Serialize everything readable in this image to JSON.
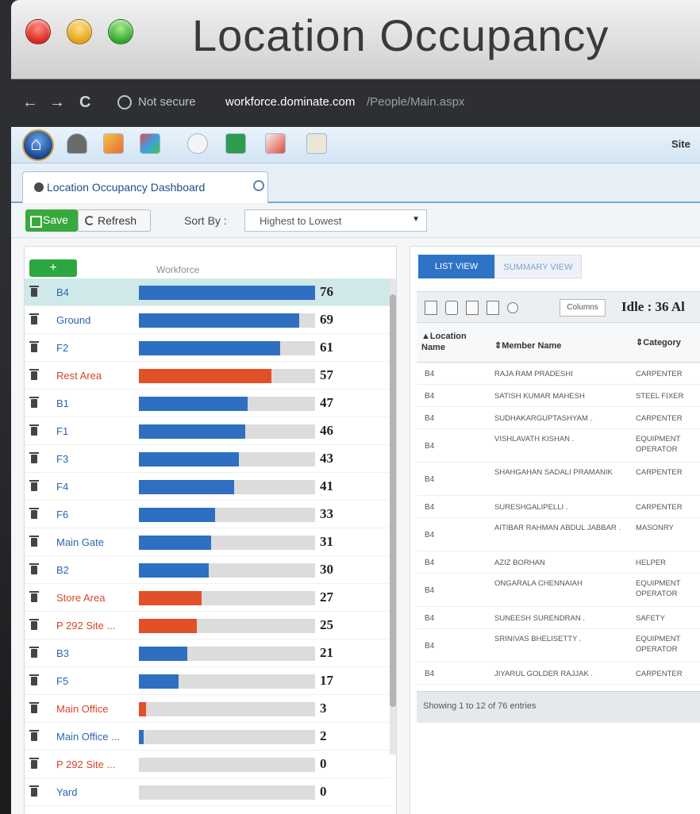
{
  "window": {
    "title": "Location Occupancy"
  },
  "browser": {
    "back": "←",
    "forward": "→",
    "reload": "C",
    "not_secure": "Not secure",
    "url_host": "workforce.dominate.com",
    "url_path": "/People/Main.aspx"
  },
  "toolbar": {
    "site_label": "Site"
  },
  "tab": {
    "label": "Location Occupancy Dashboard"
  },
  "actions": {
    "save_label": "Save",
    "refresh_label": "Refresh",
    "sort_by_label": "Sort By :",
    "sort_value": "Highest to Lowest"
  },
  "colors": {
    "blue_bar": "#2e6fc2",
    "red_bar": "#e2502a",
    "blue_text": "#2b66b3",
    "red_text": "#d8452a"
  },
  "workforce": {
    "add_label": "+",
    "header": "Workforce",
    "max": 76,
    "rows": [
      {
        "name": "B4",
        "value": 76,
        "status": "blue"
      },
      {
        "name": "Ground",
        "value": 69,
        "status": "blue"
      },
      {
        "name": "F2",
        "value": 61,
        "status": "blue"
      },
      {
        "name": "Rest Area",
        "value": 57,
        "status": "red"
      },
      {
        "name": "B1",
        "value": 47,
        "status": "blue"
      },
      {
        "name": "F1",
        "value": 46,
        "status": "blue"
      },
      {
        "name": "F3",
        "value": 43,
        "status": "blue"
      },
      {
        "name": "F4",
        "value": 41,
        "status": "blue"
      },
      {
        "name": "F6",
        "value": 33,
        "status": "blue"
      },
      {
        "name": "Main Gate",
        "value": 31,
        "status": "blue"
      },
      {
        "name": "B2",
        "value": 30,
        "status": "blue"
      },
      {
        "name": "Store Area",
        "value": 27,
        "status": "red"
      },
      {
        "name": "P 292 Site ...",
        "value": 25,
        "status": "red"
      },
      {
        "name": "B3",
        "value": 21,
        "status": "blue"
      },
      {
        "name": "F5",
        "value": 17,
        "status": "blue"
      },
      {
        "name": "Main Office",
        "value": 3,
        "status": "red"
      },
      {
        "name": "Main Office ...",
        "value": 2,
        "status": "blue"
      },
      {
        "name": "P 292 Site ...",
        "value": 0,
        "status": "red"
      },
      {
        "name": "Yard",
        "value": 0,
        "status": "blue"
      }
    ]
  },
  "list": {
    "tab_list": "LIST VIEW",
    "tab_summary": "SUMMARY VIEW",
    "columns_label": "Columns",
    "idle_label": "Idle : 36",
    "idle_suffix": "Al",
    "headers": {
      "location": "Location Name",
      "member": "Member Name",
      "category": "Category"
    },
    "rows": [
      {
        "location": "B4",
        "member": "RAJA RAM PRADESHI",
        "category": "CARPENTER"
      },
      {
        "location": "B4",
        "member": "SATISH KUMAR MAHESH",
        "category": "STEEL FIXER"
      },
      {
        "location": "B4",
        "member": "SUDHAKARGUPTASHYAM .",
        "category": "CARPENTER"
      },
      {
        "location": "B4",
        "member": "VISHLAVATH KISHAN .",
        "category": "EQUIPMENT OPERATOR"
      },
      {
        "location": "B4",
        "member": "SHAHGAHAN SADALI PRAMANIK",
        "category": "CARPENTER"
      },
      {
        "location": "B4",
        "member": "SURESHGALIPELLI .",
        "category": "CARPENTER"
      },
      {
        "location": "B4",
        "member": "AITIBAR RAHMAN ABDUL JABBAR .",
        "category": "MASONRY"
      },
      {
        "location": "B4",
        "member": "AZIZ BORHAN",
        "category": "HELPER"
      },
      {
        "location": "B4",
        "member": "ONGARALA CHENNAIAH",
        "category": "EQUIPMENT OPERATOR"
      },
      {
        "location": "B4",
        "member": "SUNEESH SURENDRAN .",
        "category": "SAFETY"
      },
      {
        "location": "B4",
        "member": "SRINIVAS BHELISETTY .",
        "category": "EQUIPMENT OPERATOR"
      },
      {
        "location": "B4",
        "member": "JIYARUL GOLDER RAJJAK .",
        "category": "CARPENTER"
      }
    ],
    "footer": "Showing 1 to 12 of 76 entries"
  }
}
